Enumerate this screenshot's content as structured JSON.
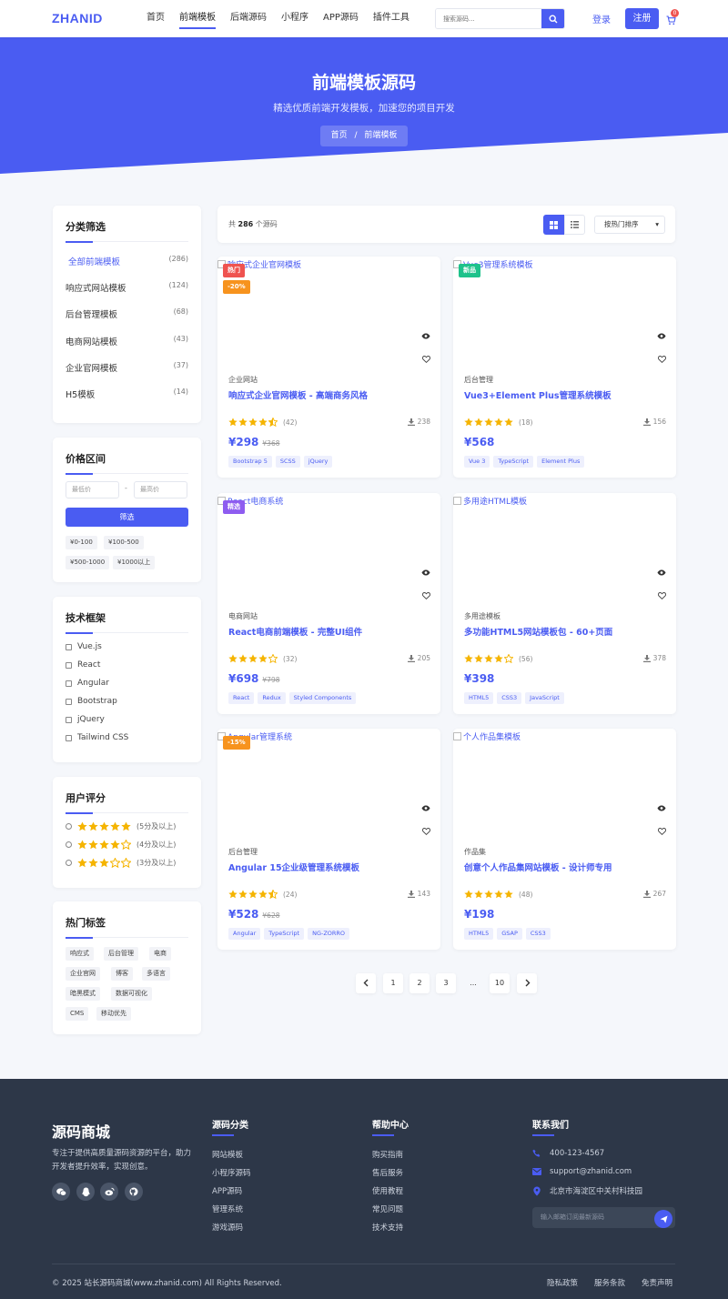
{
  "header": {
    "logo": "ZHANID",
    "nav": [
      "首页",
      "前端模板",
      "后端源码",
      "小程序",
      "APP源码",
      "插件工具"
    ],
    "active_nav": "前端模板",
    "search_placeholder": "搜索源码...",
    "login": "登录",
    "register": "注册",
    "cart_count": "0"
  },
  "hero": {
    "title": "前端模板源码",
    "subtitle": "精选优质前端开发模板，加速您的项目开发",
    "breadcrumb_home": "首页",
    "breadcrumb_sep": "/",
    "breadcrumb_current": "前端模板"
  },
  "sidebar": {
    "categories": {
      "title": "分类筛选",
      "items": [
        {
          "label": "全部前端模板",
          "count": "(286)"
        },
        {
          "label": "响应式网站模板",
          "count": "(124)"
        },
        {
          "label": "后台管理模板",
          "count": "(68)"
        },
        {
          "label": "电商网站模板",
          "count": "(43)"
        },
        {
          "label": "企业官网模板",
          "count": "(37)"
        },
        {
          "label": "H5模板",
          "count": "(14)"
        }
      ]
    },
    "price": {
      "title": "价格区间",
      "min_placeholder": "最低价",
      "max_placeholder": "最高价",
      "sep": "-",
      "button": "筛选",
      "ranges": [
        "¥0-100",
        "¥100-500",
        "¥500-1000",
        "¥1000以上"
      ]
    },
    "frameworks": {
      "title": "技术框架",
      "items": [
        "Vue.js",
        "React",
        "Angular",
        "Bootstrap",
        "jQuery",
        "Tailwind CSS"
      ]
    },
    "rating": {
      "title": "用户评分",
      "items": [
        {
          "stars": 5,
          "label": "(5分及以上)"
        },
        {
          "stars": 4,
          "label": "(4分及以上)"
        },
        {
          "stars": 3,
          "label": "(3分及以上)"
        }
      ]
    },
    "tags": {
      "title": "热门标签",
      "items": [
        "响应式",
        "后台管理",
        "电商",
        "企业官网",
        "博客",
        "多语言",
        "暗黑模式",
        "数据可视化",
        "CMS",
        "移动优先"
      ]
    }
  },
  "toolbar": {
    "total_prefix": "共",
    "total": "286",
    "total_suffix": "个源码",
    "sort": "按热门排序"
  },
  "products": [
    {
      "img_alt": "响应式企业官网模板",
      "badges": [
        {
          "text": "热门",
          "color": "#ef5350"
        },
        {
          "text": "-20%",
          "color": "#f7931e"
        }
      ],
      "category": "企业网站",
      "title": "响应式企业官网模板 - 高端商务风格",
      "rating": 4.5,
      "reviews": "(42)",
      "downloads": "238",
      "price": "¥298",
      "old_price": "¥368",
      "tags": [
        "Bootstrap 5",
        "SCSS",
        "jQuery"
      ]
    },
    {
      "img_alt": "Vue3管理系统模板",
      "badges": [
        {
          "text": "新品",
          "color": "#1ec28b"
        }
      ],
      "category": "后台管理",
      "title": "Vue3+Element Plus管理系统模板",
      "rating": 5,
      "reviews": "(18)",
      "downloads": "156",
      "price": "¥568",
      "old_price": "",
      "tags": [
        "Vue 3",
        "TypeScript",
        "Element Plus"
      ]
    },
    {
      "img_alt": "React电商系统",
      "badges": [
        {
          "text": "精选",
          "color": "#8e5cf0"
        }
      ],
      "category": "电商网站",
      "title": "React电商前端模板 - 完整UI组件",
      "rating": 4,
      "reviews": "(32)",
      "downloads": "205",
      "price": "¥698",
      "old_price": "¥798",
      "tags": [
        "React",
        "Redux",
        "Styled Components"
      ]
    },
    {
      "img_alt": "多用途HTML模板",
      "badges": [],
      "category": "多用途模板",
      "title": "多功能HTML5网站模板包 - 60+页面",
      "rating": 4,
      "reviews": "(56)",
      "downloads": "378",
      "price": "¥398",
      "old_price": "",
      "tags": [
        "HTML5",
        "CSS3",
        "JavaScript"
      ]
    },
    {
      "img_alt": "Angular管理系统",
      "badges": [
        {
          "text": "-15%",
          "color": "#f7931e"
        }
      ],
      "category": "后台管理",
      "title": "Angular 15企业级管理系统模板",
      "rating": 4.5,
      "reviews": "(24)",
      "downloads": "143",
      "price": "¥528",
      "old_price": "¥628",
      "tags": [
        "Angular",
        "TypeScript",
        "NG-ZORRO"
      ]
    },
    {
      "img_alt": "个人作品集模板",
      "badges": [],
      "category": "作品集",
      "title": "创意个人作品集网站模板 - 设计师专用",
      "rating": 5,
      "reviews": "(48)",
      "downloads": "267",
      "price": "¥198",
      "old_price": "",
      "tags": [
        "HTML5",
        "GSAP",
        "CSS3"
      ]
    }
  ],
  "pagination": [
    "1",
    "2",
    "3",
    "...",
    "10"
  ],
  "footer": {
    "brand": "源码商城",
    "desc": "专注于提供高质量源码资源的平台，助力开发者提升效率，实现创意。",
    "col1_title": "源码分类",
    "col1_links": [
      "网站模板",
      "小程序源码",
      "APP源码",
      "管理系统",
      "游戏源码"
    ],
    "col2_title": "帮助中心",
    "col2_links": [
      "购买指南",
      "售后服务",
      "使用教程",
      "常见问题",
      "技术支持"
    ],
    "col3_title": "联系我们",
    "phone": "400-123-4567",
    "email": "support@zhanid.com",
    "address": "北京市海淀区中关村科技园",
    "subscribe_placeholder": "输入邮箱订阅最新源码",
    "copyright": "© 2025 站长源码商城(www.zhanid.com) All Rights Reserved.",
    "bottom_links": [
      "隐私政策",
      "服务条款",
      "免责声明"
    ]
  },
  "colors": {
    "accent": "#4a5cf2",
    "star": "#f5b400",
    "footer_bg": "#2d3748"
  }
}
